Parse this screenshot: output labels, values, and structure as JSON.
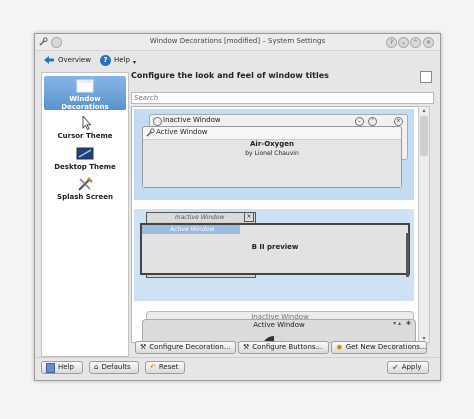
{
  "window": {
    "title": "Window Decorations [modified] – System Settings",
    "controls": [
      "help-icon",
      "minimize-icon",
      "maximize-icon",
      "close-icon"
    ]
  },
  "toolbar": {
    "overview_label": "Overview",
    "help_label": "Help"
  },
  "sidebar": {
    "items": [
      {
        "label_1": "Window",
        "label_2": "Decorations",
        "icon": "window-icon",
        "selected": true
      },
      {
        "label_1": "Cursor Theme",
        "icon": "cursor-icon"
      },
      {
        "label_1": "Desktop Theme",
        "icon": "desktop-icon"
      },
      {
        "label_1": "Splash Screen",
        "icon": "splash-icon"
      }
    ]
  },
  "main": {
    "header": "Configure the look and feel of window titles",
    "search_placeholder": "Search",
    "decorations": [
      {
        "inactive_title": "Inactive Window",
        "active_title": "Active Window",
        "name": "Air-Oxygen",
        "author": "by Lionel Chauvin",
        "selected": true
      },
      {
        "inactive_title": "Inactive Window",
        "active_title": "Active Window",
        "preview_text": "B II preview"
      },
      {
        "inactive_title": "Inactive Window",
        "active_title": "Active Window"
      }
    ],
    "buttons": {
      "configure_decoration": "Configure Decoration...",
      "configure_buttons": "Configure Buttons...",
      "get_new": "Get New Decorations..."
    }
  },
  "footer": {
    "help": "Help",
    "defaults": "Defaults",
    "reset": "Reset",
    "apply": "Apply"
  },
  "colors": {
    "selection": "#c3dcf2",
    "sidebar_selected": "#5b92cf",
    "apply_accent": "#3a9a3a"
  }
}
